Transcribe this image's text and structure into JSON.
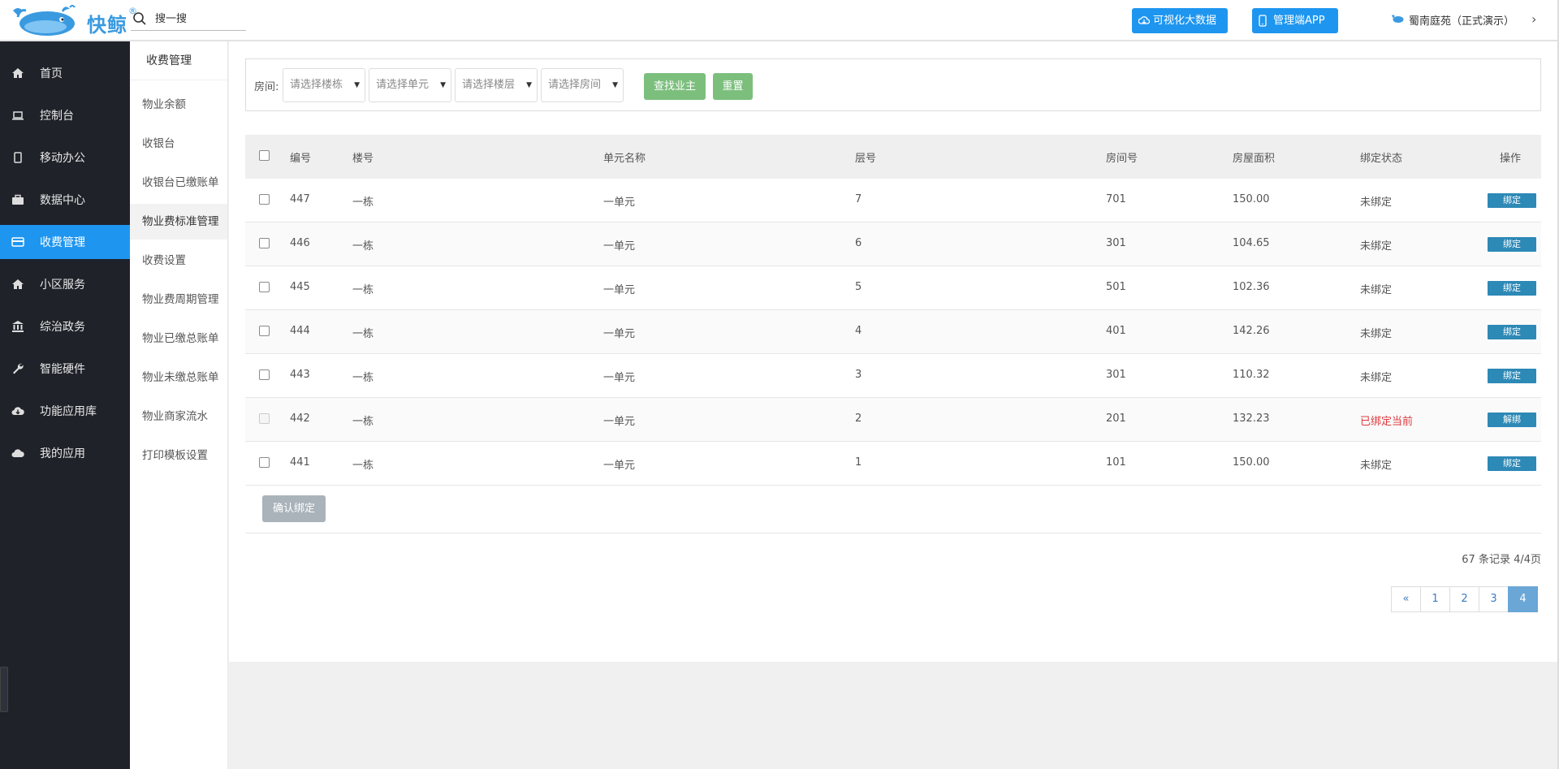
{
  "brand": {
    "name": "快鲸",
    "reg": "®"
  },
  "search": {
    "placeholder": "搜一搜"
  },
  "header": {
    "bigdata_label": "可视化大数据",
    "app_label": "管理端APP",
    "community": "蜀南庭苑（正式演示）",
    "chevron": "›"
  },
  "sidebar": {
    "items": [
      {
        "label": "首页",
        "icon": "home-icon"
      },
      {
        "label": "控制台",
        "icon": "laptop-icon"
      },
      {
        "label": "移动办公",
        "icon": "mobile-icon"
      },
      {
        "label": "数据中心",
        "icon": "briefcase-icon"
      },
      {
        "label": "收费管理",
        "icon": "credit-card-icon",
        "active": true
      },
      {
        "label": "小区服务",
        "icon": "home-icon"
      },
      {
        "label": "综治政务",
        "icon": "bank-icon"
      },
      {
        "label": "智能硬件",
        "icon": "wrench-icon"
      },
      {
        "label": "功能应用库",
        "icon": "cloud-download-icon"
      },
      {
        "label": "我的应用",
        "icon": "cloud-icon"
      }
    ]
  },
  "submenu": {
    "title": "收费管理",
    "items": [
      "物业余额",
      "收银台",
      "收银台已缴账单",
      "物业费标准管理",
      "收费设置",
      "物业费周期管理",
      "物业已缴总账单",
      "物业未缴总账单",
      "物业商家流水",
      "打印模板设置"
    ]
  },
  "filter": {
    "label": "房间:",
    "building": "请选择楼栋",
    "unit": "请选择单元",
    "floor": "请选择楼层",
    "room": "请选择房间",
    "find_btn": "查找业主",
    "reset_btn": "重置"
  },
  "table": {
    "headers": [
      "编号",
      "楼号",
      "单元名称",
      "层号",
      "房间号",
      "房屋面积",
      "绑定状态",
      "操作"
    ],
    "rows": [
      {
        "id": "447",
        "building": "一栋",
        "unit": "一单元",
        "floor": "7",
        "room": "701",
        "area": "150.00",
        "status": "未绑定",
        "action": "绑定"
      },
      {
        "id": "446",
        "building": "一栋",
        "unit": "一单元",
        "floor": "6",
        "room": "301",
        "area": "104.65",
        "status": "未绑定",
        "action": "绑定"
      },
      {
        "id": "445",
        "building": "一栋",
        "unit": "一单元",
        "floor": "5",
        "room": "501",
        "area": "102.36",
        "status": "未绑定",
        "action": "绑定"
      },
      {
        "id": "444",
        "building": "一栋",
        "unit": "一单元",
        "floor": "4",
        "room": "401",
        "area": "142.26",
        "status": "未绑定",
        "action": "绑定"
      },
      {
        "id": "443",
        "building": "一栋",
        "unit": "一单元",
        "floor": "3",
        "room": "301",
        "area": "110.32",
        "status": "未绑定",
        "action": "绑定"
      },
      {
        "id": "442",
        "building": "一栋",
        "unit": "一单元",
        "floor": "2",
        "room": "201",
        "area": "132.23",
        "status": "已绑定当前",
        "action": "解绑"
      },
      {
        "id": "441",
        "building": "一栋",
        "unit": "一单元",
        "floor": "1",
        "room": "101",
        "area": "150.00",
        "status": "未绑定",
        "action": "绑定"
      }
    ]
  },
  "confirm_btn": "确认绑定",
  "pagination": {
    "summary": "67 条记录 4/4页",
    "prev": "«",
    "pages": [
      "1",
      "2",
      "3",
      "4"
    ],
    "current": "4"
  },
  "colors": {
    "accent": "#1e96f0",
    "sidebar_bg": "#1f2229",
    "green": "#7cbf7d",
    "bind_btn": "#2d89b6",
    "bound_red": "#e0393e"
  }
}
